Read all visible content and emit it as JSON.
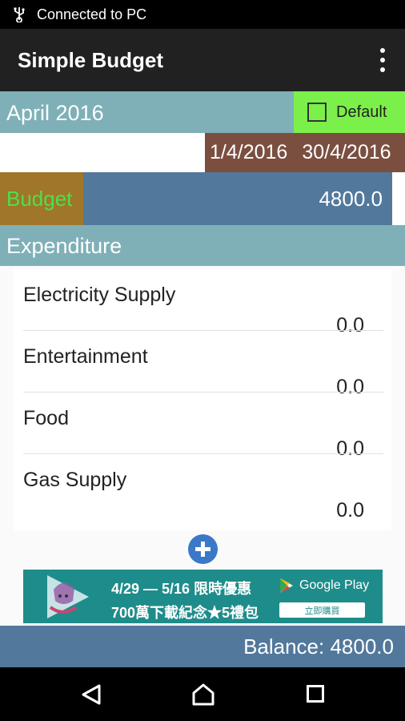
{
  "status_bar": {
    "text": "Connected to PC",
    "icon": "usb-icon"
  },
  "app_bar": {
    "title": "Simple Budget",
    "menu_icon": "more-vert-icon"
  },
  "period": {
    "month": "April 2016",
    "default_label": "Default",
    "default_checked": false,
    "start_date": "1/4/2016",
    "end_date": "30/4/2016"
  },
  "budget": {
    "label": "Budget",
    "value": "4800.0"
  },
  "expenditure": {
    "header": "Expenditure",
    "items": [
      {
        "name": "Electricity Supply",
        "amount": "0.0"
      },
      {
        "name": "Entertainment",
        "amount": "0.0"
      },
      {
        "name": "Food",
        "amount": "0.0"
      },
      {
        "name": "Gas Supply",
        "amount": "0.0"
      }
    ]
  },
  "ad": {
    "line1": "4/29 — 5/16 限時優惠",
    "line2": "700萬下載紀念★5禮包",
    "store": "Google Play",
    "cta": "立即購買"
  },
  "footer": {
    "balance": "Balance: 4800.0"
  },
  "nav": {
    "back_icon": "back-icon",
    "home_icon": "home-icon",
    "recents_icon": "recents-icon"
  },
  "colors": {
    "month_bg": "#7fb0b8",
    "default_bg": "#7cf04a",
    "dates_bg": "#7b4f40",
    "budget_label_bg": "#a0762a",
    "budget_label_text": "#4ce04a",
    "budget_value_bg": "#52789c",
    "add_button": "#3b78c7",
    "ad_bg": "#1e8c8a"
  }
}
